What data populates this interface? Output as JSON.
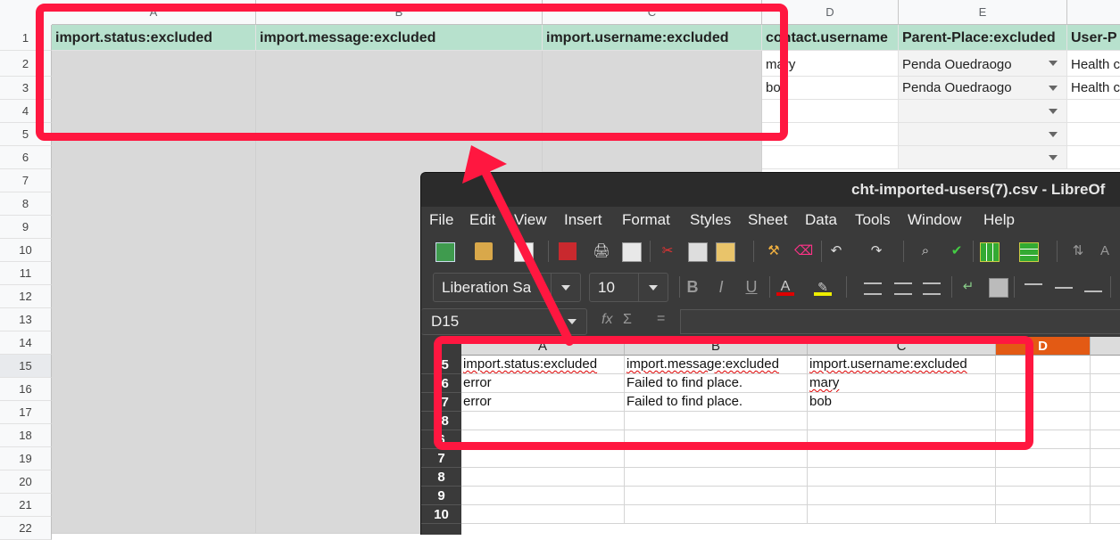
{
  "sheets": {
    "columns": [
      "A",
      "B",
      "C",
      "D",
      "E"
    ],
    "rows": [
      "1",
      "2",
      "3",
      "4",
      "5",
      "6",
      "7",
      "8",
      "9",
      "10",
      "11",
      "12",
      "13",
      "14",
      "15",
      "16",
      "17",
      "18",
      "19",
      "20",
      "21",
      "22"
    ],
    "header": {
      "a": "import.status:excluded",
      "b": "import.message:excluded",
      "c": "import.username:excluded",
      "d": "contact.username",
      "e": "Parent-Place:excluded",
      "f": "User-P"
    },
    "data": [
      {
        "d": "mary",
        "e": "Penda Ouedraogo",
        "f": "Health c"
      },
      {
        "d": "bob",
        "e": "Penda Ouedraogo",
        "f": "Health c"
      }
    ]
  },
  "libreoffice": {
    "title": "cht-imported-users(7).csv - LibreOf",
    "menu": [
      "File",
      "Edit",
      "View",
      "Insert",
      "Format",
      "Styles",
      "Sheet",
      "Data",
      "Tools",
      "Window",
      "Help"
    ],
    "font_name": "Liberation Sa",
    "font_size": "10",
    "name_box": "D15",
    "fx": "fx",
    "sigma": "Σ",
    "equals": "=",
    "columns": [
      "A",
      "B",
      "C",
      "D"
    ],
    "row_numbers": [
      "15",
      "16",
      "17",
      "18",
      "6",
      "7",
      "8",
      "9",
      "10"
    ],
    "cells": [
      [
        "import.status:excluded",
        "import.message:excluded",
        "import.username:excluded"
      ],
      [
        "error",
        "Failed to find place.",
        "mary"
      ],
      [
        "error",
        "Failed to find place.",
        "bob"
      ]
    ]
  },
  "colors": {
    "annotation": "#ff1740",
    "header_fill": "#b7e1cd",
    "lo_selected_col": "#e35a14"
  }
}
